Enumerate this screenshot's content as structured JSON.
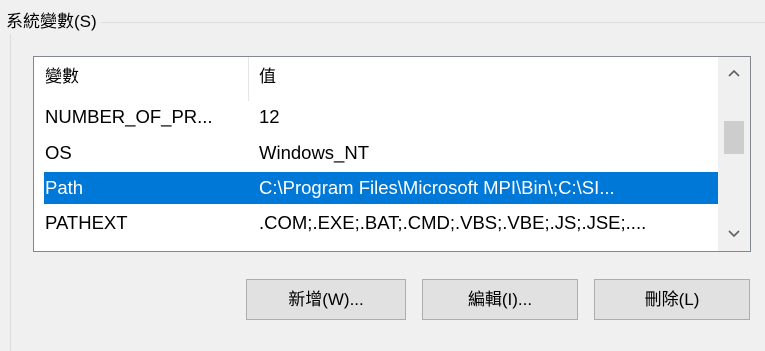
{
  "groupbox": {
    "title": "系統變數(S)"
  },
  "list": {
    "columns": [
      "變數",
      "值"
    ],
    "rows": [
      {
        "name": "NUMBER_OF_PR...",
        "value": "12",
        "selected": false
      },
      {
        "name": "OS",
        "value": "Windows_NT",
        "selected": false
      },
      {
        "name": "Path",
        "value": "C:\\Program Files\\Microsoft MPI\\Bin\\;C:\\SI...",
        "selected": true
      },
      {
        "name": "PATHEXT",
        "value": ".COM;.EXE;.BAT;.CMD;.VBS;.VBE;.JS;.JSE;....",
        "selected": false
      }
    ]
  },
  "scrollbar": {
    "up_icon": "chevron-up-icon",
    "down_icon": "chevron-down-icon"
  },
  "buttons": {
    "new_label": "新增(W)...",
    "edit_label": "編輯(I)...",
    "delete_label": "刪除(L)"
  },
  "colors": {
    "selection": "#0078d7",
    "background": "#f0f0f0"
  }
}
